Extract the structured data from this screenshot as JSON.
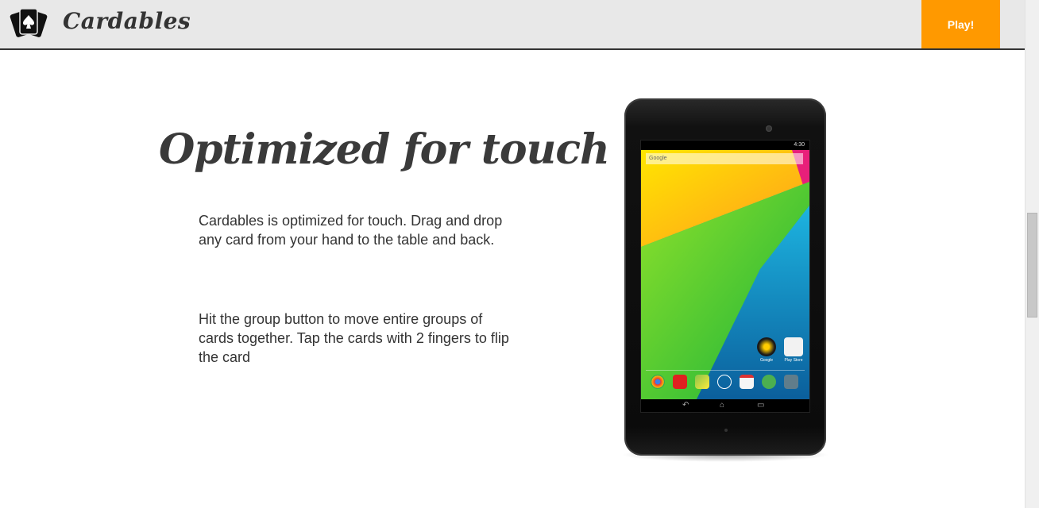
{
  "header": {
    "brand": "Cardables",
    "play_label": "Play!"
  },
  "main": {
    "headline": "Optimized for touch",
    "paragraphs": [
      "Cardables is optimized for touch. Drag and drop any card from your hand to the table and back.",
      "Hit the group button to move entire groups of cards together. Tap the cards with 2 fingers to flip the card"
    ]
  },
  "device": {
    "status_time": "4:30",
    "search_label": "Google",
    "icons": [
      {
        "label": "Google"
      },
      {
        "label": "Play Store"
      }
    ]
  },
  "colors": {
    "accent": "#ff9900",
    "header_bg": "#e8e8e8",
    "text": "#333333"
  },
  "icons": {
    "logo": "playing-cards-spade-icon"
  }
}
